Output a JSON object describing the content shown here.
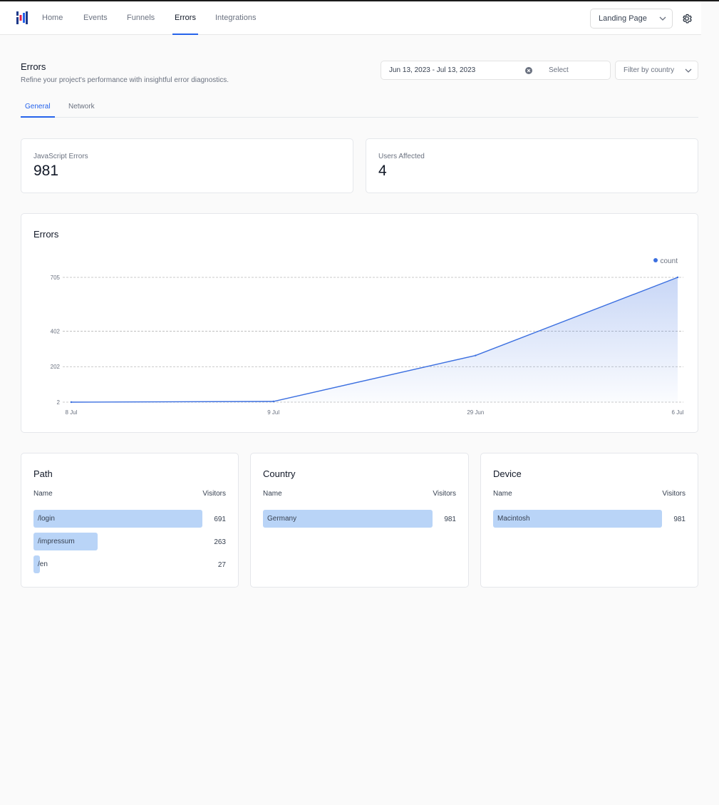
{
  "nav": {
    "links": [
      {
        "label": "Home",
        "active": false
      },
      {
        "label": "Events",
        "active": false
      },
      {
        "label": "Funnels",
        "active": false
      },
      {
        "label": "Errors",
        "active": true
      },
      {
        "label": "Integrations",
        "active": false
      }
    ],
    "project": "Landing Page",
    "logo_icon": "bar-logo-icon",
    "settings_icon": "gear-icon"
  },
  "header": {
    "title": "Errors",
    "subtitle": "Refine your project's performance with insightful error diagnostics."
  },
  "filters": {
    "date_range": "Jun 13, 2023 - Jul 13, 2023",
    "select_placeholder": "Select",
    "country_placeholder": "Filter by country"
  },
  "tabs": [
    {
      "label": "General",
      "active": true
    },
    {
      "label": "Network",
      "active": false
    }
  ],
  "kpis": [
    {
      "label": "JavaScript Errors",
      "value": "981"
    },
    {
      "label": "Users Affected",
      "value": "4"
    }
  ],
  "errors_card": {
    "title": "Errors",
    "legend": "count"
  },
  "chart_data": {
    "type": "area",
    "categories": [
      "8 Jul",
      "9 Jul",
      "29 Jun",
      "6 Jul"
    ],
    "series": [
      {
        "name": "count",
        "values": [
          2,
          6,
          265,
          705
        ]
      }
    ],
    "yticks": [
      2,
      202,
      402,
      705
    ],
    "ylim": [
      2,
      705
    ],
    "grid": true,
    "legend_position": "top-right",
    "color": "#3b6fe0"
  },
  "tables": [
    {
      "title": "Path",
      "col_name": "Name",
      "col_value": "Visitors",
      "rows": [
        {
          "name": "/login",
          "value": 691
        },
        {
          "name": "/impressum",
          "value": 263
        },
        {
          "name": "/en",
          "value": 27
        }
      ]
    },
    {
      "title": "Country",
      "col_name": "Name",
      "col_value": "Visitors",
      "rows": [
        {
          "name": "Germany",
          "value": 981
        }
      ]
    },
    {
      "title": "Device",
      "col_name": "Name",
      "col_value": "Visitors",
      "rows": [
        {
          "name": "Macintosh",
          "value": 981
        }
      ]
    }
  ],
  "colors": {
    "accent": "#2563eb",
    "bar": "#b9d4f7"
  }
}
